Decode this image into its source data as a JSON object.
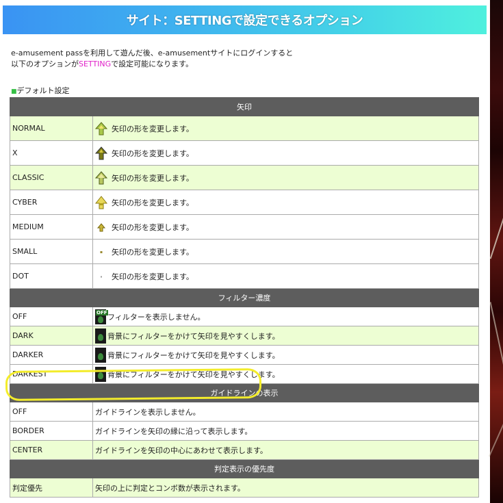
{
  "page": {
    "title": "サイト：SETTINGで設定できるオプション",
    "intro_line1": "e-amusement passを利用して遊んだ後、e-amusementサイトにログインすると",
    "intro_line2_pre": "以下のオプションが",
    "intro_line2_highlight": "SETTING",
    "intro_line2_post": "で設定可能になります。",
    "section_label": "デフォルト設定"
  },
  "colors": {
    "header_bg": "#5d5d5d",
    "row_green": "#edfed3",
    "highlight_text": "#e020c8",
    "annotation_ring": "#f3ec2b",
    "title_gradient_start": "#3a93f3",
    "title_gradient_end": "#4ff0de"
  },
  "sections": {
    "arrow": {
      "header": "矢印",
      "rows": [
        {
          "name": "NORMAL",
          "icon": "arrow-normal-icon",
          "desc": "矢印の形を変更します。"
        },
        {
          "name": "X",
          "icon": "arrow-x-icon",
          "desc": "矢印の形を変更します。"
        },
        {
          "name": "CLASSIC",
          "icon": "arrow-classic-icon",
          "desc": "矢印の形を変更します。"
        },
        {
          "name": "CYBER",
          "icon": "arrow-cyber-icon",
          "desc": "矢印の形を変更します。"
        },
        {
          "name": "MEDIUM",
          "icon": "arrow-medium-icon",
          "desc": "矢印の形を変更します。"
        },
        {
          "name": "SMALL",
          "icon": "arrow-small-icon",
          "desc": "矢印の形を変更します。"
        },
        {
          "name": "DOT",
          "icon": "arrow-dot-icon",
          "desc": "矢印の形を変更します。"
        }
      ]
    },
    "filter": {
      "header": "フィルター濃度",
      "off_badge": "OFF",
      "rows": [
        {
          "name": "OFF",
          "icon": "filter-off-icon",
          "desc": "フィルターを表示しません。"
        },
        {
          "name": "DARK",
          "icon": "filter-dark-icon",
          "desc": "背景にフィルターをかけて矢印を見やすくします。"
        },
        {
          "name": "DARKER",
          "icon": "filter-darker-icon",
          "desc": "背景にフィルターをかけて矢印を見やすくします。"
        },
        {
          "name": "DARKEST",
          "icon": "filter-darkest-icon",
          "desc": "背景にフィルターをかけて矢印を見やすくします。"
        }
      ]
    },
    "guideline": {
      "header": "ガイドラインの表示",
      "rows": [
        {
          "name": "OFF",
          "desc": "ガイドラインを表示しません。"
        },
        {
          "name": "BORDER",
          "desc": "ガイドラインを矢印の縁に沿って表示します。"
        },
        {
          "name": "CENTER",
          "desc": "ガイドラインを矢印の中心にあわせて表示します。"
        }
      ]
    },
    "judge": {
      "header": "判定表示の優先度",
      "rows": [
        {
          "name": "判定優先",
          "desc": "矢印の上に判定とコンボ数が表示されます。"
        }
      ]
    }
  }
}
